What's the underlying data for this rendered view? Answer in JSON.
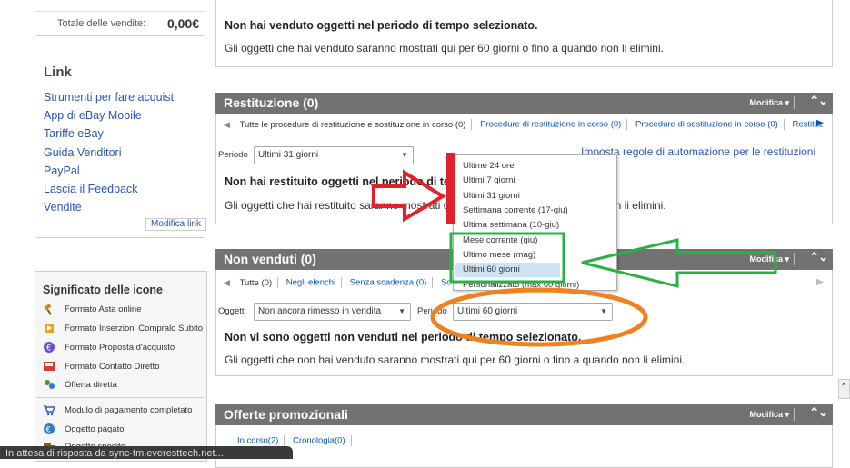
{
  "sidebar": {
    "totale_label": "Totale delle vendite:",
    "totale_value": "0,00€",
    "link_title": "Link",
    "links": [
      "Strumenti per fare acquisti",
      "App di eBay Mobile",
      "Tariffe eBay",
      "Guida Venditori",
      "PayPal",
      "Lascia il Feedback",
      "Vendite"
    ],
    "modifica_link": "Modifica link",
    "icons_title": "Significato delle icone",
    "icons": [
      {
        "label": "Formato Asta online",
        "icon": "gavel-icon"
      },
      {
        "label": "Formato Inserzioni Compralo Subito",
        "icon": "buy-it-now-icon"
      },
      {
        "label": "Formato Proposta d'acquisto",
        "icon": "best-offer-icon"
      },
      {
        "label": "Formato Contatto Diretto",
        "icon": "classified-icon"
      },
      {
        "label": "Offerta diretta",
        "icon": "direct-offer-icon"
      },
      {
        "label": "Modulo di pagamento completato",
        "icon": "cart-icon"
      },
      {
        "label": "Oggetto pagato",
        "icon": "euro-icon"
      },
      {
        "label": "Oggetto spedito",
        "icon": "shipped-icon"
      }
    ]
  },
  "venduti": {
    "empty_title": "Non hai venduto oggetti nel periodo di tempo selezionato.",
    "empty_text": "Gli oggetti che hai venduto saranno mostrati qui per 60 giorni o fino a quando non li elimini."
  },
  "restituzione": {
    "title": "Restituzione (0)",
    "modifica": "Modifica",
    "tabs": [
      "Tutte le procedure di restituzione e sostituzione in corso (0)",
      "Procedure di restituzione in corso (0)",
      "Procedure di sostituzione in corso (0)",
      "Restituzi"
    ],
    "periodo_label": "Periodo",
    "periodo_value": "Ultimi 31 giorni",
    "automation_link": "Imposta regole di automazione per le restituzioni",
    "empty_title": "Non hai restituito oggetti nel periodo di tempo selezionato.",
    "empty_text": "Gli oggetti che hai restituito saranno mostrati qui per 60 giorni o fino a quando non li elimini."
  },
  "dropdown": {
    "options": [
      "Ultime 24 ore",
      "Ultimi 7 giorni",
      "Ultimi 31 giorni",
      "Settimana corrente (17-giu)",
      "Ultima settimana (10-giu)",
      "Mese corrente (giu)",
      "Ultimo mese (mag)",
      "Ultimi 60 giorni",
      "Personalizzato (max 60 giorni)"
    ],
    "selected": "Ultimi 60 giorni"
  },
  "non_venduti": {
    "title": "Non venduti (0)",
    "modifica": "Modifica",
    "tabs": [
      "Tutte (0)",
      "Negli elenchi",
      "Senza scadenza (0)",
      "Scad"
    ],
    "oggetti_label": "Oggetti",
    "oggetti_value": "Non ancora rimesso in vendita",
    "periodo_label": "Periodo",
    "periodo_value": "Ultimi 60 giorni",
    "empty_title": "Non vi sono oggetti non venduti nel periodo di tempo selezionato.",
    "empty_text": "Gli oggetti che non hai venduto saranno mostrati qui per 60 giorni o fino a quando non li elimini."
  },
  "offerte": {
    "title": "Offerte promozionali",
    "modifica": "Modifica",
    "tabs": [
      "In corso(2)",
      "Cronologia(0)"
    ]
  },
  "status_bar": "In attesa di risposta da sync-tm.everesttech.net...",
  "colors": {
    "panel_header": "#727272",
    "link": "#2a54b7",
    "annotation_red": "#e3212b",
    "annotation_green": "#2ab045",
    "annotation_orange": "#f0811e"
  }
}
